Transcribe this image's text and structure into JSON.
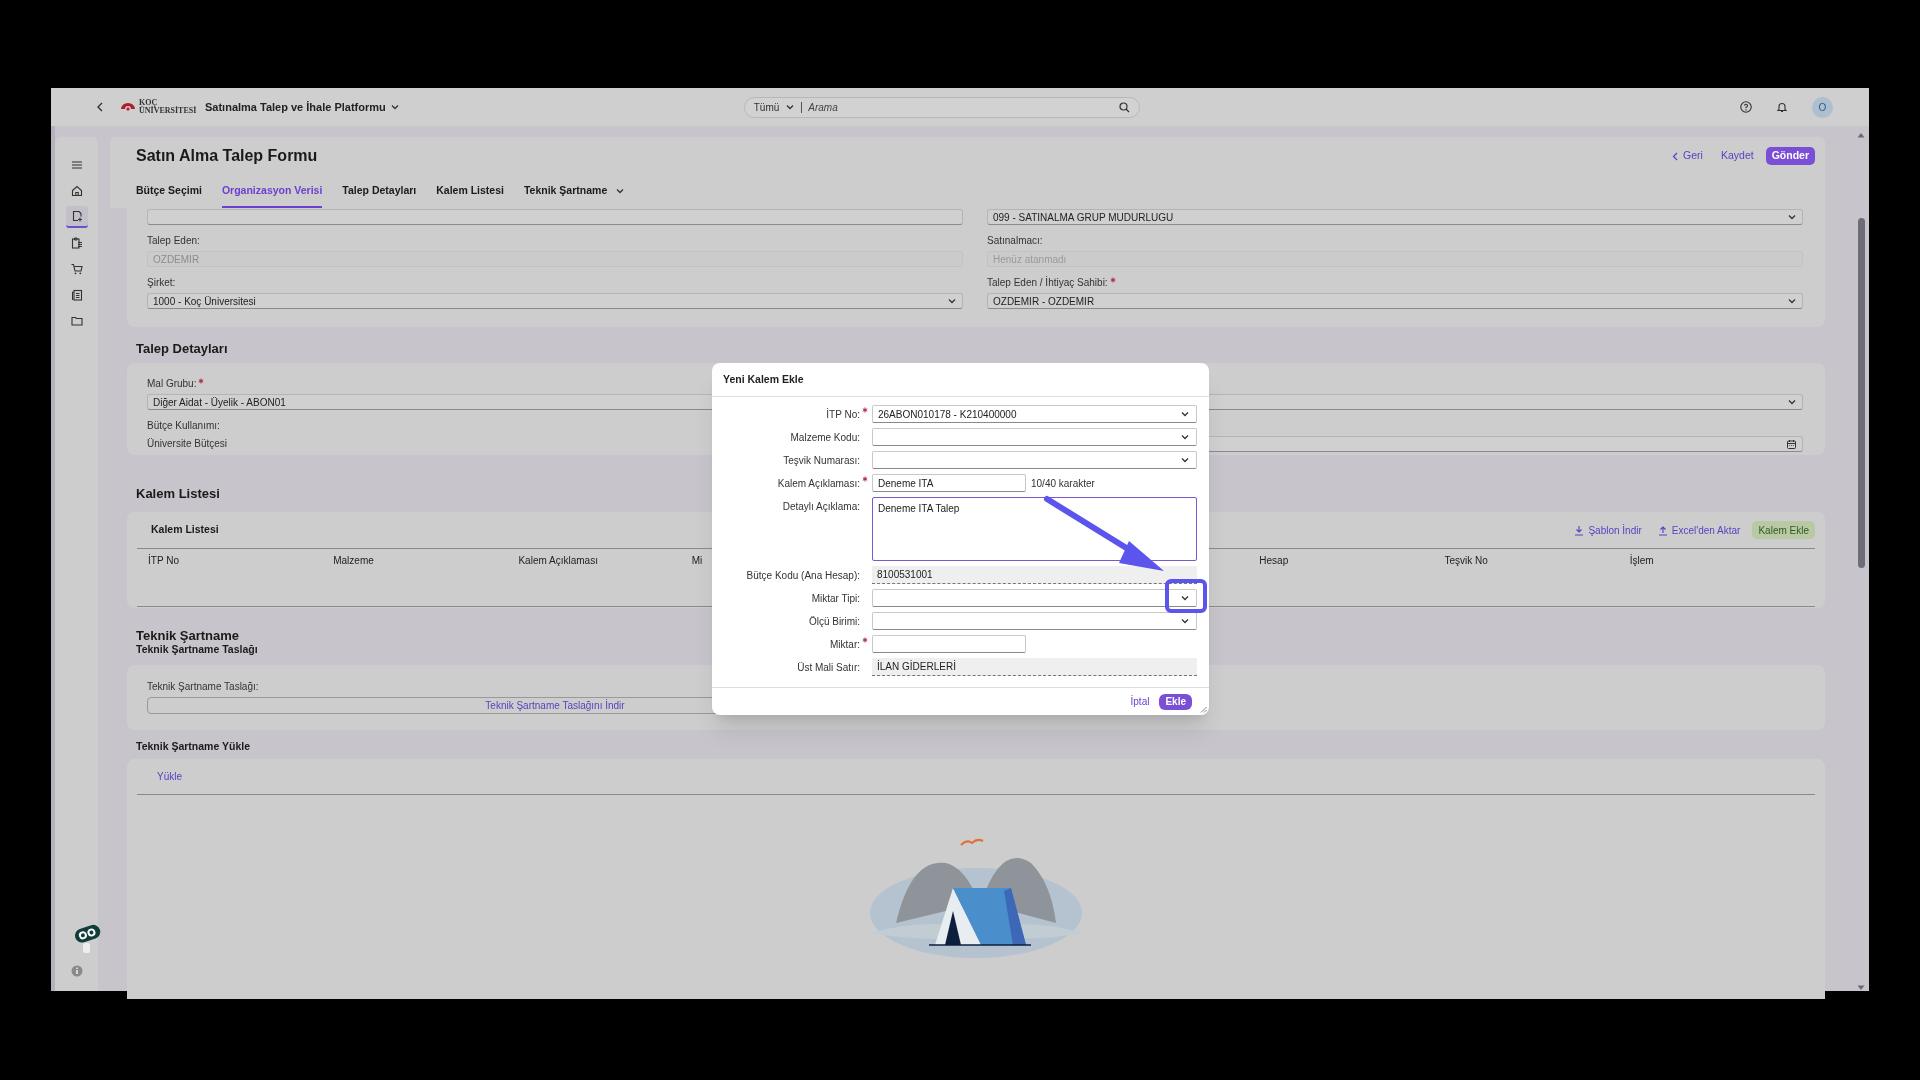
{
  "top_bar": {
    "logo_text": "KOÇ ÜNİVERSİTESİ",
    "app_title": "Satınalma Talep ve İhale Platformu",
    "search": {
      "scope": "Tümü",
      "placeholder": "Arama"
    },
    "avatar": "O"
  },
  "sidebar": {
    "items": [
      {
        "kind": "menu",
        "selected": false
      },
      {
        "kind": "home",
        "selected": false
      },
      {
        "kind": "new-request",
        "selected": true
      },
      {
        "kind": "clipboard",
        "selected": false
      },
      {
        "kind": "cart",
        "selected": false
      },
      {
        "kind": "documents",
        "selected": false
      },
      {
        "kind": "folder",
        "selected": false
      }
    ]
  },
  "header": {
    "title": "Satın Alma Talep Formu",
    "actions": [
      {
        "kind": "back",
        "label": "Geri"
      },
      {
        "kind": "link",
        "label": "Kaydet"
      },
      {
        "kind": "primary",
        "label": "Gönder"
      }
    ],
    "tabs": [
      {
        "label": "Bütçe Seçimi",
        "selected": false,
        "has_menu": false
      },
      {
        "label": "Organizasyon Verisi",
        "selected": true,
        "has_menu": false
      },
      {
        "label": "Talep Detayları",
        "selected": false,
        "has_menu": false
      },
      {
        "label": "Kalem Listesi",
        "selected": false,
        "has_menu": false
      },
      {
        "label": "Teknik Şartname",
        "selected": false,
        "has_menu": true
      }
    ]
  },
  "organization": {
    "rows": [
      [
        {
          "kind": "text",
          "disabled": false
        },
        {
          "kind": "select",
          "value": "099 - SATINALMA GRUP MUDURLUGU",
          "disabled": false
        }
      ],
      [
        {
          "kind": "text",
          "label": "Talep Eden:",
          "value": "OZDEMIR",
          "required": false,
          "disabled": true
        },
        {
          "kind": "text",
          "label": "Satınalmacı:",
          "placeholder": "Henüz atanmadı",
          "required": false,
          "disabled": true
        }
      ],
      [
        {
          "kind": "select",
          "label": "Şirket:",
          "value": "1000 - Koç Üniversitesi",
          "required": false,
          "disabled": false
        },
        {
          "kind": "select",
          "label": "Talep Eden / İhtiyaç Sahibi:",
          "value": "OZDEMIR - OZDEMIR",
          "required": true,
          "disabled": false
        }
      ]
    ]
  },
  "request_details": {
    "heading": "Talep Detayları",
    "group": {
      "kind": "select",
      "label": "Mal Grubu:",
      "value": "Diğer Aidat - Üyelik - ABON01",
      "required": true,
      "disabled": false
    },
    "budget_use": {
      "label": "Bütçe Kullanımı:",
      "value": "Üniversite Bütçesi"
    },
    "date_field": {
      "kind": "date",
      "disabled": false
    }
  },
  "items": {
    "heading": "Kalem Listesi",
    "table": {
      "title": "Kalem Listesi",
      "actions": [
        {
          "kind": "download",
          "label": "Şablon İndir"
        },
        {
          "kind": "upload",
          "label": "Excel'den Aktar"
        },
        {
          "kind": "add",
          "label": "Kalem Ekle"
        }
      ],
      "columns": [
        "İTP No",
        "Malzeme",
        "Kalem Açıklaması",
        "Mi",
        "Hesap",
        "Teşvik No",
        "İşlem"
      ]
    }
  },
  "specification": {
    "heading": "Teknik Şartname",
    "subheading": "Teknik Şartname Taslağı",
    "draft_label": "Teknik Şartname Taslağı:",
    "draft_link": "Teknik Şartname Taslağını İndir",
    "upload_heading": "Teknik Şartname Yükle",
    "upload_tab": "Yükle"
  },
  "dialog": {
    "title": "Yeni Kalem Ekle",
    "fields": [
      {
        "kind": "select",
        "label": "İTP No:",
        "required": true,
        "value": "26ABON010178 - K210400000"
      },
      {
        "kind": "select",
        "label": "Malzeme Kodu:",
        "required": false
      },
      {
        "kind": "select",
        "label": "Teşvik Numarası:",
        "required": false
      },
      {
        "kind": "short",
        "label": "Kalem Açıklaması:",
        "required": true,
        "value": "Deneme ITA",
        "counter": "10/40 karakter"
      },
      {
        "kind": "textarea",
        "label": "Detaylı Açıklama:",
        "required": false,
        "value": "Deneme ITA Talep"
      },
      {
        "kind": "readonly",
        "label": "Bütçe Kodu (Ana Hesap):",
        "required": false,
        "value": "8100531001"
      },
      {
        "kind": "select",
        "label": "Miktar Tipi:",
        "required": false
      },
      {
        "kind": "select",
        "label": "Ölçü Birimi:",
        "required": false
      },
      {
        "kind": "short",
        "label": "Miktar:",
        "required": true
      },
      {
        "kind": "readonly",
        "label": "Üst Mali Satır:",
        "required": false,
        "value": "İLAN GİDERLERİ"
      }
    ],
    "buttons": [
      {
        "kind": "cancel",
        "label": "İptal"
      },
      {
        "kind": "primary",
        "label": "Ekle"
      }
    ]
  }
}
